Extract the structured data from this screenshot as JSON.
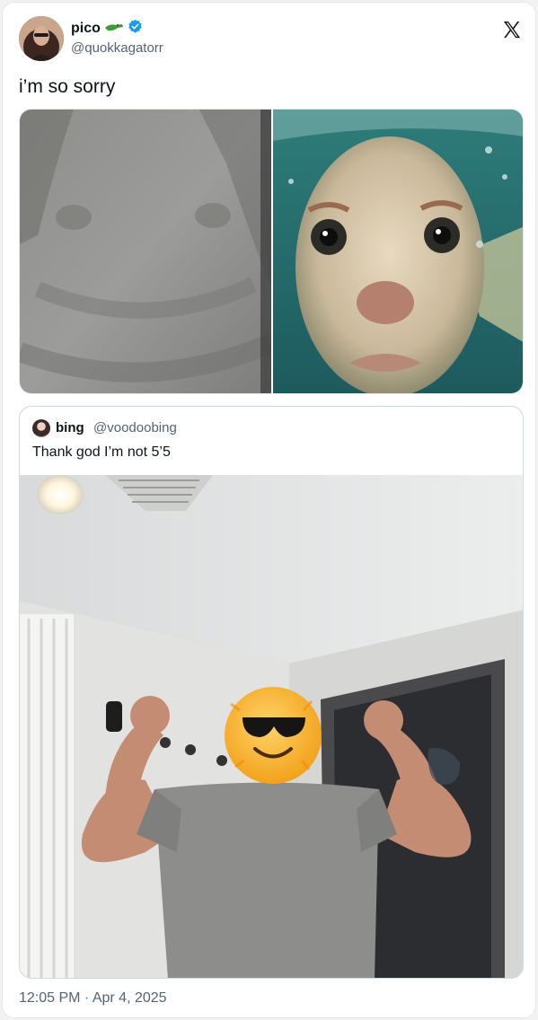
{
  "post": {
    "author": {
      "display_name": "pico",
      "handle": "@quokkagatorr",
      "emoji_icon": "crocodile-emoji-icon",
      "verified_icon": "verified-badge-icon"
    },
    "text": "i’m so sorry",
    "timestamp": "12:05 PM · Apr 4, 2025"
  },
  "quoted_post": {
    "display_name": "bing",
    "handle": "@voodoobing",
    "text": "Thank god I’m not 5’5"
  },
  "colors": {
    "verified": "#1d9bf0",
    "secondary_text": "#536471",
    "border": "#cfd9de"
  }
}
